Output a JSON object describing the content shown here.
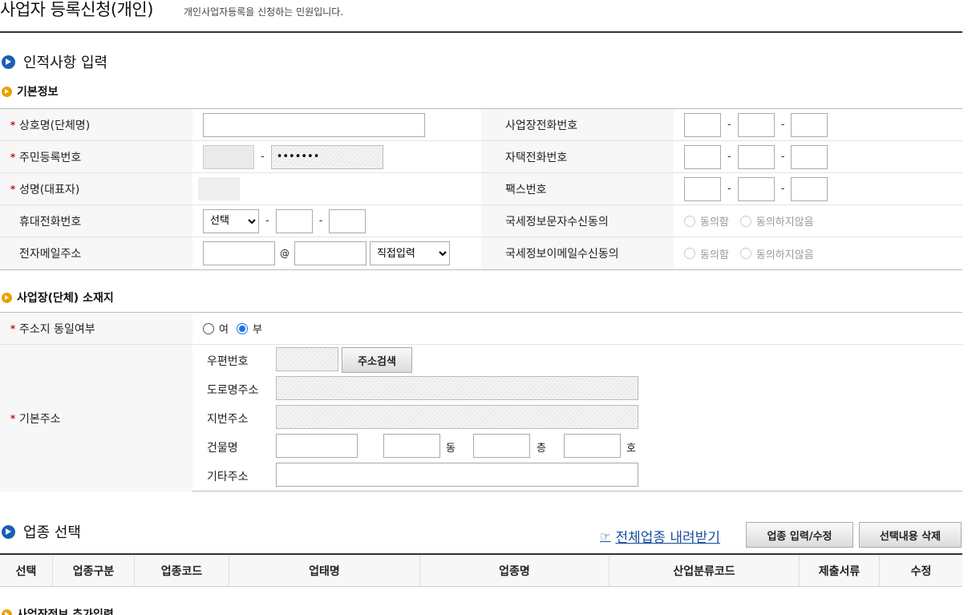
{
  "page": {
    "title": "사업자 등록신청(개인)",
    "description": "개인사업자등록을 신청하는 민원입니다."
  },
  "section1": {
    "title": "인적사항 입력",
    "basic": {
      "title": "기본정보",
      "trade_name_label": "상호명(단체명)",
      "resident_no_label": "주민등록번호",
      "resident_no_masked": "•••••••",
      "name_label": "성명(대표자)",
      "mobile_label": "휴대전화번호",
      "mobile_select": "선택",
      "email_label": "전자메일주소",
      "email_at": "@",
      "email_select": "직접입력",
      "biz_phone_label": "사업장전화번호",
      "home_phone_label": "자택전화번호",
      "fax_label": "팩스번호",
      "sms_consent_label": "국세정보문자수신동의",
      "email_consent_label": "국세정보이메일수신동의",
      "agree": "동의함",
      "disagree": "동의하지않음",
      "dash": "-"
    },
    "location": {
      "title": "사업장(단체) 소재지",
      "same_addr_label": "주소지 동일여부",
      "yes": "여",
      "no": "부",
      "basic_addr_label": "기본주소",
      "zip_label": "우편번호",
      "search_button": "주소검색",
      "road_addr_label": "도로명주소",
      "lot_addr_label": "지번주소",
      "building_label": "건물명",
      "dong": "동",
      "floor": "층",
      "ho": "호",
      "etc_addr_label": "기타주소"
    }
  },
  "section2": {
    "title": "업종 선택",
    "download_link": "전체업종 내려받기",
    "input_button": "업종 입력/수정",
    "delete_button": "선택내용 삭제",
    "columns": [
      "선택",
      "업종구분",
      "업종코드",
      "업태명",
      "업종명",
      "산업분류코드",
      "제출서류",
      "수정"
    ]
  },
  "section3": {
    "title": "사업장정보 추가입력"
  }
}
